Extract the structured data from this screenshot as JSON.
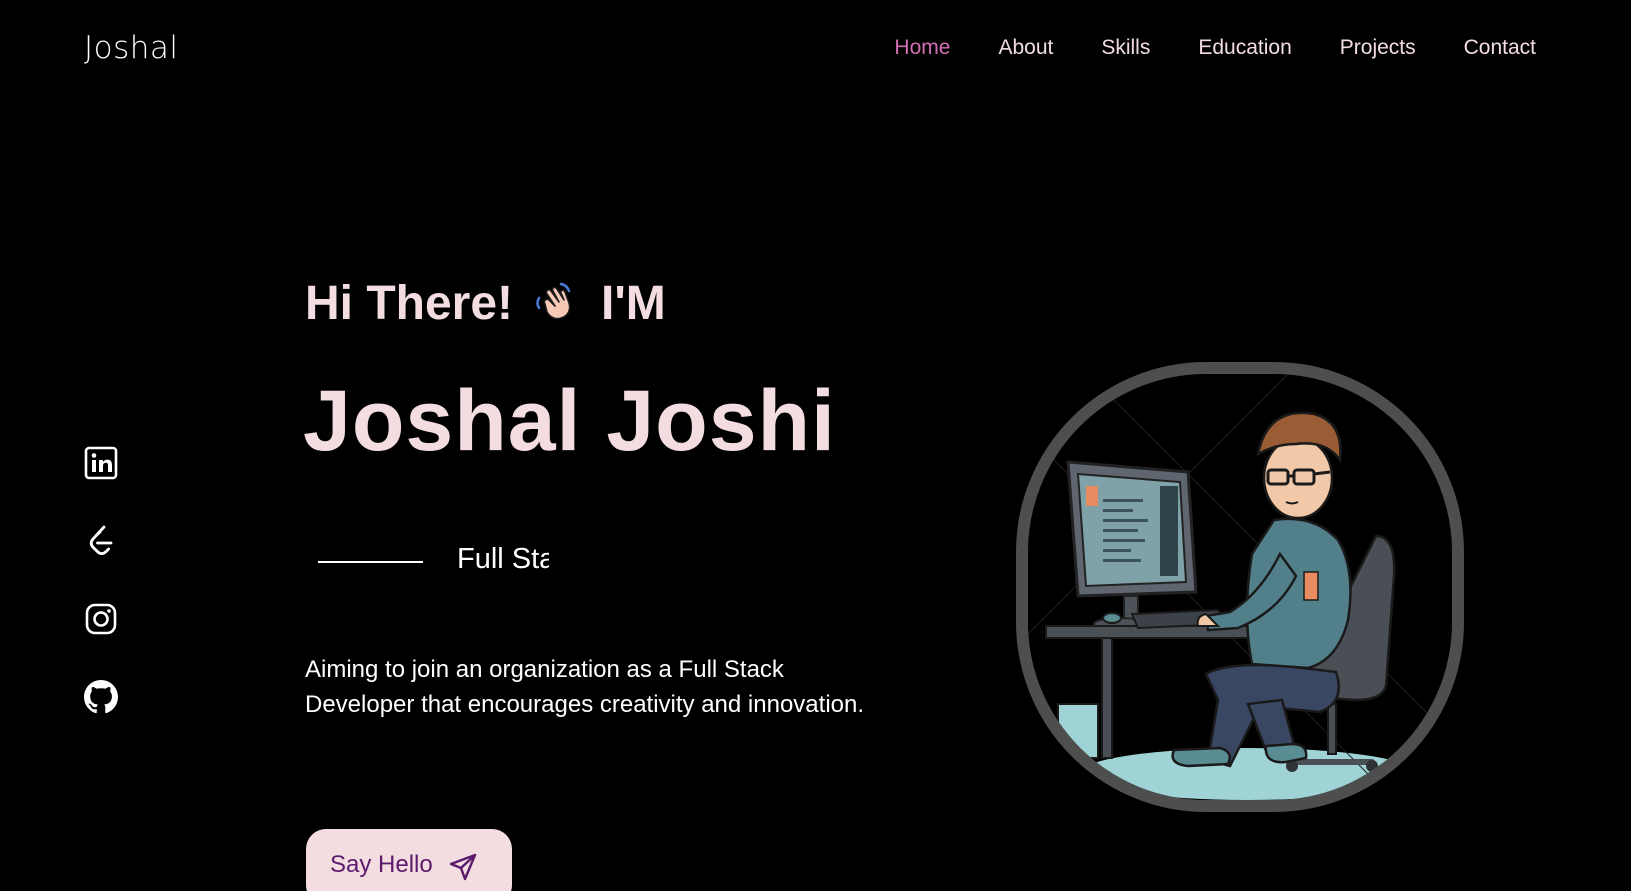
{
  "header": {
    "logo": "Joshal",
    "nav": [
      {
        "label": "Home",
        "active": true
      },
      {
        "label": "About",
        "active": false
      },
      {
        "label": "Skills",
        "active": false
      },
      {
        "label": "Education",
        "active": false
      },
      {
        "label": "Projects",
        "active": false
      },
      {
        "label": "Contact",
        "active": false
      }
    ]
  },
  "social": [
    {
      "icon": "linkedin-icon"
    },
    {
      "icon": "leetcode-icon"
    },
    {
      "icon": "instagram-icon"
    },
    {
      "icon": "github-icon"
    }
  ],
  "hero": {
    "greeting_prefix": "Hi There!",
    "greeting_suffix": "I'M",
    "wave_icon": "waving-hand-icon",
    "name": "Joshal Joshi",
    "role_typing": "Full Sta",
    "description": "Aiming to join an organization as a Full Stack Developer that encourages creativity and innovation.",
    "cta_label": "Say Hello",
    "cta_icon": "paper-plane-icon"
  },
  "colors": {
    "background": "#000000",
    "accent": "#d26fb3",
    "text_pink": "#f3dde0",
    "button_text": "#5b1a6b",
    "frame": "#4e4e4e"
  }
}
